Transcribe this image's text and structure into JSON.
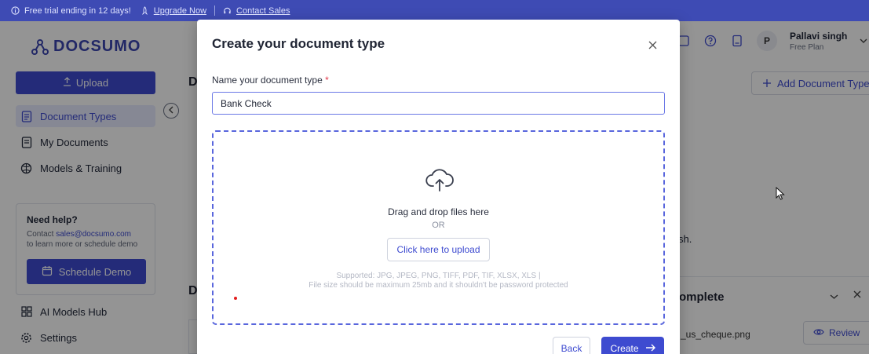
{
  "banner": {
    "trial_text": "Free trial ending in 12 days!",
    "upgrade_link": "Upgrade Now",
    "contact_link": "Contact Sales"
  },
  "sidebar": {
    "logo_text": "DOCSUMO",
    "upload_label": "Upload",
    "items": [
      {
        "label": "Document Types",
        "icon": "document-types-icon",
        "active": true
      },
      {
        "label": "My Documents",
        "icon": "my-documents-icon",
        "active": false
      },
      {
        "label": "Models & Training",
        "icon": "models-training-icon",
        "active": false
      },
      {
        "label": "AI Models Hub",
        "icon": "ai-models-hub-icon",
        "active": false
      },
      {
        "label": "Settings",
        "icon": "settings-icon",
        "active": false
      }
    ],
    "help": {
      "title": "Need help?",
      "contact_prefix": "Contact ",
      "email": "sales@docsumo.com",
      "contact_suffix": "to learn more or schedule demo",
      "demo_button": "Schedule Demo"
    }
  },
  "header": {
    "user_initial": "P",
    "user_name": "Pallavi singh",
    "user_plan": "Free Plan"
  },
  "background": {
    "title_initial": "D",
    "section_initial": "D",
    "add_document_type": "Add Document Type",
    "partial_text": "sh.",
    "complete_title": "omplete",
    "complete_file": "_us_cheque.png",
    "review_button": "Review"
  },
  "modal": {
    "title": "Create your document type",
    "name_label": "Name your document type",
    "required_mark": "*",
    "name_value": "Bank Check",
    "drag_text": "Drag and drop files here",
    "or_text": "OR",
    "upload_button": "Click here to upload",
    "supported_text": "Supported: JPG, JPEG, PNG, TIFF, PDF, TIF, XLSX, XLS |",
    "filesize_text": "File size should be maximum 25mb and it shouldn't be password protected",
    "back_button": "Back",
    "create_button": "Create"
  },
  "colors": {
    "primary": "#3e4bd0",
    "banner": "#3e4bb4",
    "required": "#e2394a"
  }
}
